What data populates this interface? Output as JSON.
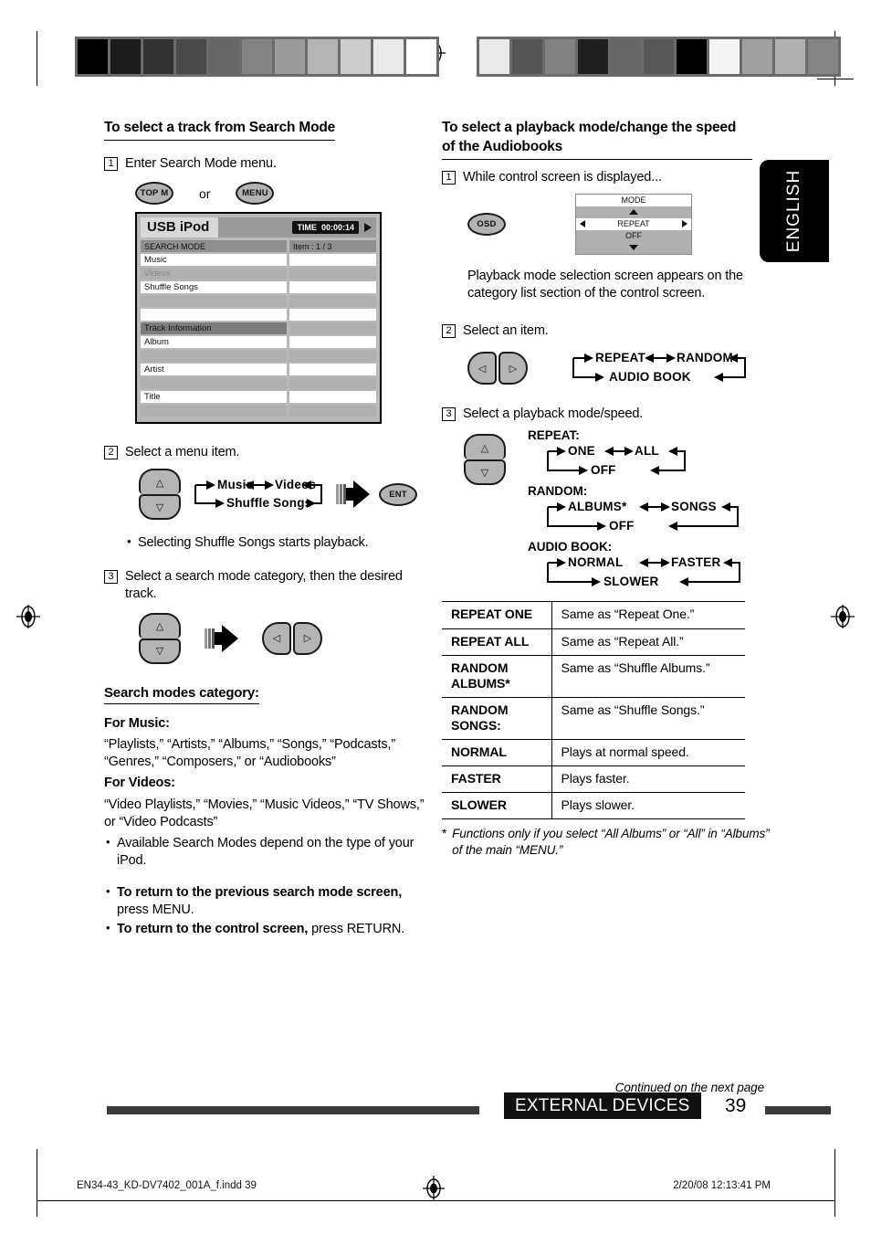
{
  "language_tab": "ENGLISH",
  "left_column": {
    "heading": "To select a track from Search Mode",
    "step1": {
      "num": "1",
      "text": "Enter Search Mode menu.",
      "button_a": "TOP M",
      "conjunction": "or",
      "button_b": "MENU"
    },
    "screen": {
      "title": "USB iPod",
      "time_label": "TIME",
      "time_value": "00:00:14",
      "left_header": "SEARCH MODE",
      "right_header": "Item : 1 / 3",
      "items": [
        "Music",
        "Videos",
        "Shuffle Songs"
      ],
      "track_info_header": "Track Information",
      "track_fields": [
        "Album",
        "Artist",
        "Title"
      ]
    },
    "step2": {
      "num": "2",
      "text": "Select a menu item.",
      "cycle": [
        "Music",
        "Videos",
        "Shuffle Songs"
      ],
      "enter_button": "ENT",
      "note": "Selecting Shuffle Songs starts playback."
    },
    "step3": {
      "num": "3",
      "text": "Select a search mode category, then the desired track."
    },
    "search_modes": {
      "heading": "Search modes category:",
      "music_label": "For Music:",
      "music_list": "“Playlists,” “Artists,” “Albums,” “Songs,” “Podcasts,” “Genres,” “Composers,” or “Audiobooks”",
      "videos_label": "For Videos:",
      "videos_list": "“Video Playlists,” “Movies,” “Music Videos,” “TV Shows,” or “Video Podcasts”",
      "note": "Available Search Modes depend on the type of your iPod."
    },
    "return_notes": [
      {
        "bold": "To return to the previous search mode screen,",
        "rest": " press MENU."
      },
      {
        "bold": "To return to the control screen,",
        "rest": " press RETURN."
      }
    ]
  },
  "right_column": {
    "heading": "To select a playback mode/change the speed of the Audiobooks",
    "step1": {
      "num": "1",
      "text": "While control screen is displayed...",
      "button": "OSD",
      "osd_panel": {
        "title": "MODE",
        "item": "REPEAT",
        "value": "OFF"
      },
      "description": "Playback mode selection screen appears on the category list section of the control screen."
    },
    "step2": {
      "num": "2",
      "text": "Select an item.",
      "cycle": [
        "REPEAT",
        "RANDOM",
        "AUDIO BOOK"
      ]
    },
    "step3": {
      "num": "3",
      "text": "Select a playback mode/speed.",
      "groups": [
        {
          "label": "REPEAT:",
          "cycle": [
            "ONE",
            "ALL",
            "OFF"
          ]
        },
        {
          "label": "RANDOM:",
          "cycle": [
            "ALBUMS*",
            "SONGS",
            "OFF"
          ]
        },
        {
          "label": "AUDIO BOOK:",
          "cycle": [
            "NORMAL",
            "FASTER",
            "SLOWER"
          ]
        }
      ]
    },
    "table": {
      "rows": [
        {
          "mode": "REPEAT ONE",
          "desc": "Same as “Repeat One.”"
        },
        {
          "mode": "REPEAT ALL",
          "desc": "Same as “Repeat All.”"
        },
        {
          "mode": "RANDOM ALBUMS*",
          "desc": "Same as “Shuffle Albums.”"
        },
        {
          "mode": "RANDOM SONGS:",
          "desc": "Same as “Shuffle Songs.”"
        },
        {
          "mode": "NORMAL",
          "desc": "Plays at normal speed."
        },
        {
          "mode": "FASTER",
          "desc": "Plays faster."
        },
        {
          "mode": "SLOWER",
          "desc": "Plays slower."
        }
      ]
    },
    "footnote": {
      "marker": "*",
      "text": "Functions only if you select “All Albums” or “All” in “Albums” of the main “MENU.”"
    }
  },
  "footer": {
    "continued": "Continued on the next page",
    "section": "EXTERNAL DEVICES",
    "page_number": "39",
    "print_file": "EN34-43_KD-DV7402_001A_f.indd   39",
    "print_date": "2/20/08   12:13:41 PM"
  },
  "calibration": {
    "left_swatches": [
      "#000000",
      "#1c1c1c",
      "#333333",
      "#4a4a4a",
      "#666666",
      "#838383",
      "#9b9b9b",
      "#b4b4b4",
      "#cccccc",
      "#e9e9e9",
      "#ffffff"
    ],
    "right_swatches": [
      "#e9e9e9",
      "#555555",
      "#818181",
      "#1f1f1f",
      "#666666",
      "#575757",
      "#000000",
      "#f4f4f4",
      "#a0a0a0",
      "#b0b0b0",
      "#858585"
    ]
  }
}
